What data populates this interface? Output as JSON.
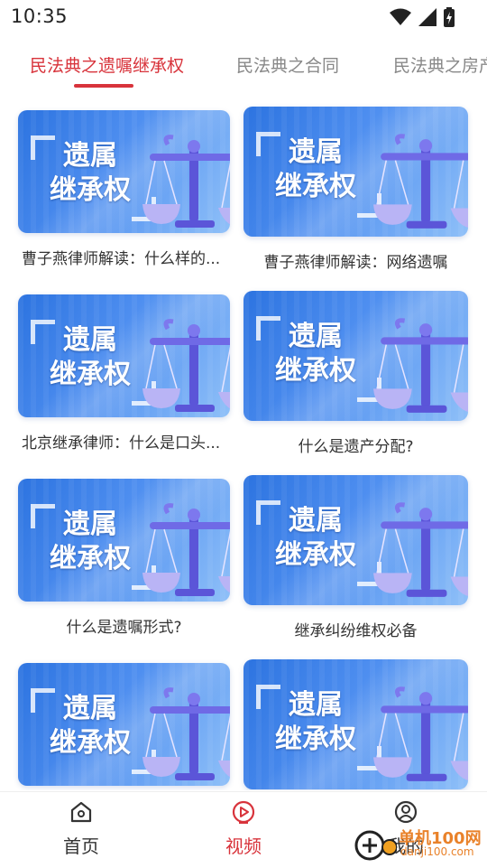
{
  "status_bar": {
    "time": "10:35",
    "icons": [
      "wifi-icon",
      "signal-icon",
      "battery-icon"
    ]
  },
  "tabs": [
    {
      "label": "民法典之遗嘱继承权",
      "active": true
    },
    {
      "label": "民法典之合同",
      "active": false
    },
    {
      "label": "民法典之房产",
      "active": false
    }
  ],
  "thumbnail_text": {
    "line1": "遗属",
    "line2": "继承权"
  },
  "cards": [
    {
      "caption": "曹子燕律师解读：什么样的..."
    },
    {
      "caption": "曹子燕律师解读：网络遗嘱"
    },
    {
      "caption": "北京继承律师：什么是口头..."
    },
    {
      "caption": "什么是遗产分配?"
    },
    {
      "caption": "什么是遗嘱形式?"
    },
    {
      "caption": "继承纠纷维权必备"
    },
    {
      "caption": ""
    },
    {
      "caption": ""
    }
  ],
  "bottom_nav": [
    {
      "label": "首页",
      "icon": "home-icon",
      "active": false
    },
    {
      "label": "视频",
      "icon": "play-icon",
      "active": true
    },
    {
      "label": "我的",
      "icon": "profile-icon",
      "active": false
    }
  ],
  "watermark": {
    "text": "单机100网",
    "url": "danji100.com"
  },
  "colors": {
    "accent": "#d8333b",
    "thumb_blue": "#3d80e8",
    "scale_purple": "#6f6ae6"
  }
}
